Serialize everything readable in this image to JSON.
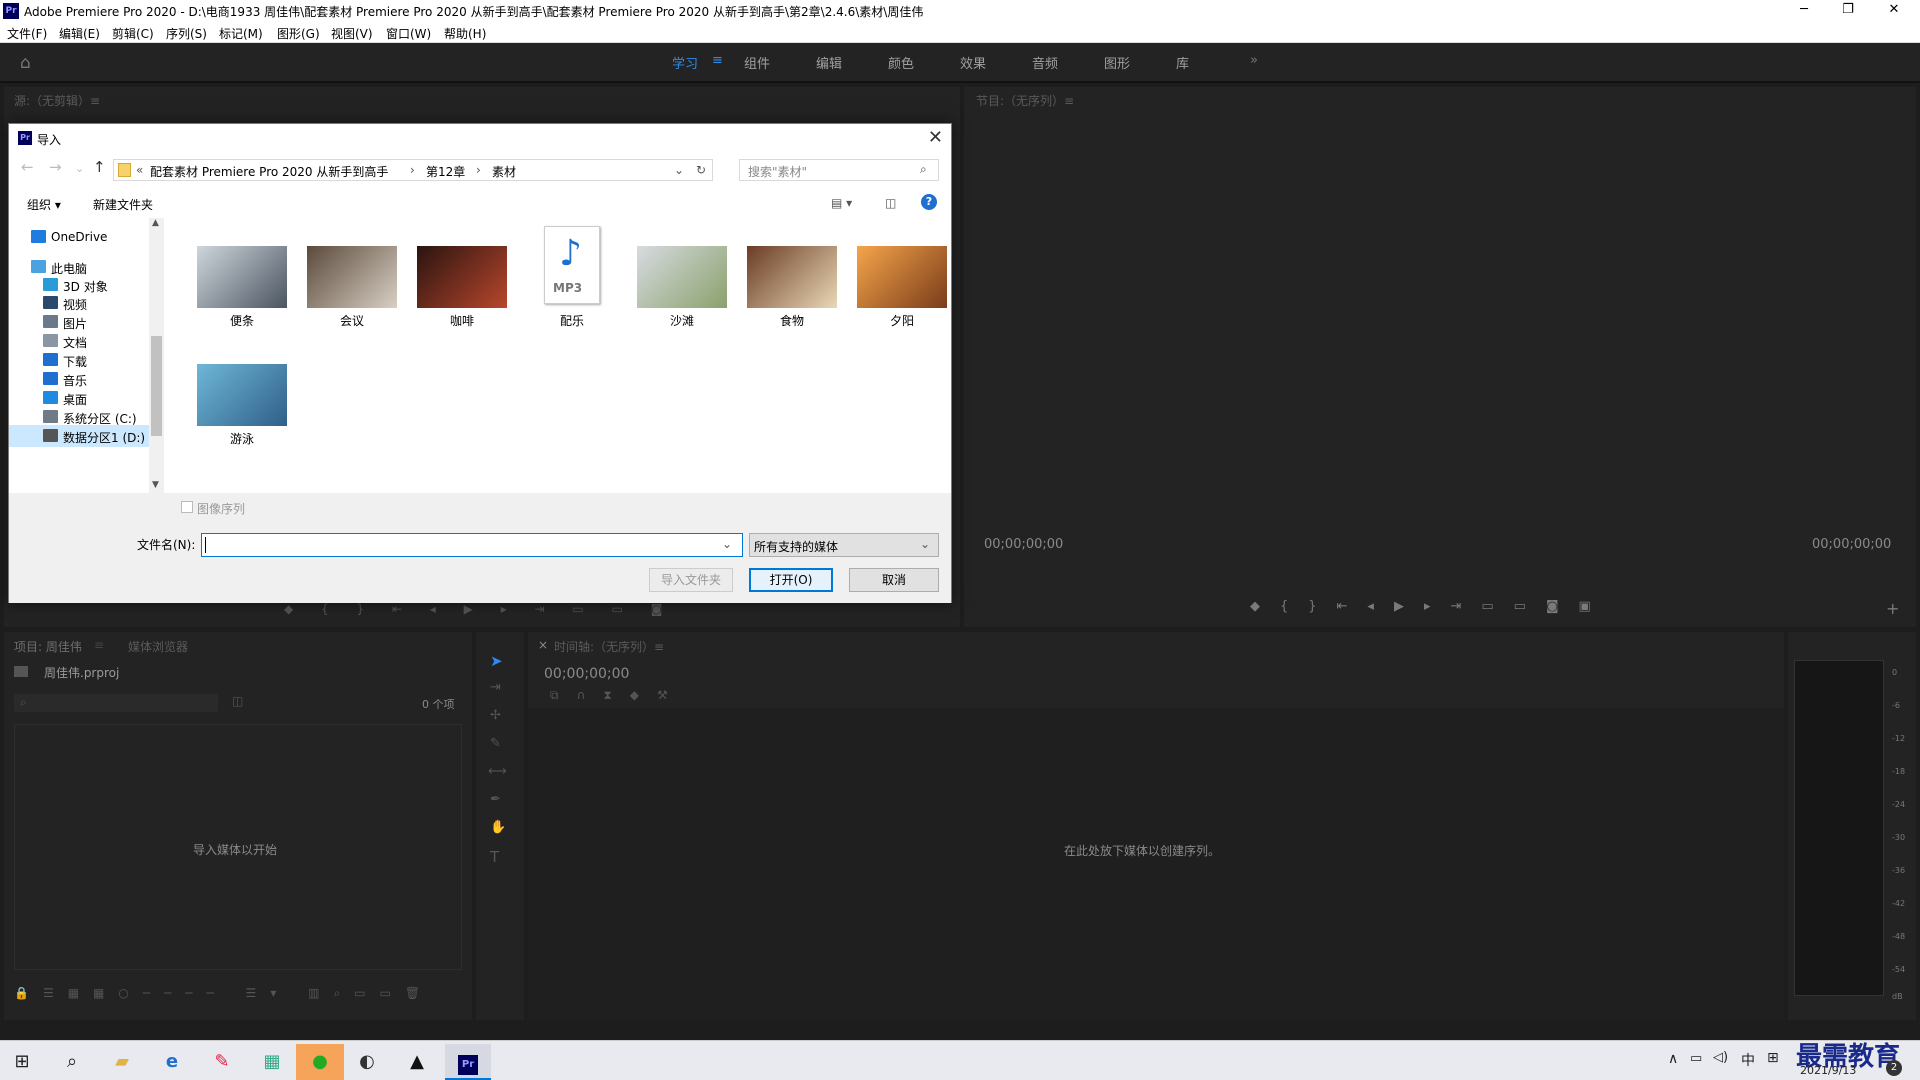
{
  "window": {
    "title": "Adobe Premiere Pro 2020 - D:\\电商1933 周佳伟\\配套素材 Premiere Pro 2020 从新手到高手\\配套素材 Premiere Pro 2020 从新手到高手\\第2章\\2.4.6\\素材\\周佳伟",
    "app_icon": "Pr",
    "min": "─",
    "max": "❐",
    "close": "✕"
  },
  "menu": [
    "文件(F)",
    "编辑(E)",
    "剪辑(C)",
    "序列(S)",
    "标记(M)",
    "图形(G)",
    "视图(V)",
    "窗口(W)",
    "帮助(H)"
  ],
  "workspaces": {
    "tabs": [
      "学习",
      "组件",
      "编辑",
      "颜色",
      "效果",
      "音频",
      "图形",
      "库"
    ],
    "active": "学习",
    "more": "»"
  },
  "source_panel": {
    "title": "源:（无剪辑）≡"
  },
  "program_panel": {
    "title": "节目:（无序列）≡",
    "timecode_left": "00;00;00;00",
    "timecode_right": "00;00;00;00"
  },
  "dialog": {
    "icon": "Pr",
    "title": "导入",
    "close": "✕",
    "nav": {
      "back": "←",
      "forward": "→",
      "recent": "⌄",
      "up": "↑",
      "refresh": "↻"
    },
    "address": {
      "prefix": "«",
      "parts": [
        "配套素材 Premiere Pro 2020 从新手到高手",
        "第12章",
        "素材"
      ],
      "sep": "›",
      "dropdown": "⌄"
    },
    "search": {
      "placeholder": "搜索\"素材\"",
      "icon": "⌕"
    },
    "toolbar": {
      "organize": "组织 ▾",
      "new_folder": "新建文件夹",
      "view": "▤ ▾",
      "pane": "◫",
      "help": "?"
    },
    "nav_pane": [
      {
        "label": "OneDrive",
        "icon": "cloud",
        "color": "#1e7be0"
      },
      {
        "label": "此电脑",
        "icon": "computer",
        "color": "#4aa3df"
      },
      {
        "label": "3D 对象",
        "icon": "cube",
        "color": "#2b9bd8"
      },
      {
        "label": "视频",
        "icon": "film",
        "color": "#2a4a6c"
      },
      {
        "label": "图片",
        "icon": "image",
        "color": "#6a7a8a"
      },
      {
        "label": "文档",
        "icon": "doc",
        "color": "#8a96a4"
      },
      {
        "label": "下载",
        "icon": "download",
        "color": "#1e6fd0"
      },
      {
        "label": "音乐",
        "icon": "music",
        "color": "#1e6fd0"
      },
      {
        "label": "桌面",
        "icon": "desktop",
        "color": "#1e8ae0"
      },
      {
        "label": "系统分区 (C:)",
        "icon": "drive",
        "color": "#6f7b86"
      },
      {
        "label": "数据分区1 (D:)",
        "icon": "drive",
        "color": "#555"
      }
    ],
    "files": [
      {
        "name": "便条",
        "type": "image",
        "c1": "#cfd6dd",
        "c2": "#4b5560"
      },
      {
        "name": "会议",
        "type": "image",
        "c1": "#5a4a3c",
        "c2": "#d8cfc3"
      },
      {
        "name": "咖啡",
        "type": "image",
        "c1": "#2a1410",
        "c2": "#b8462c"
      },
      {
        "name": "配乐",
        "type": "mp3",
        "label": "MP3"
      },
      {
        "name": "沙滩",
        "type": "image",
        "c1": "#d7dbe0",
        "c2": "#8aa16c"
      },
      {
        "name": "食物",
        "type": "image",
        "c1": "#6a3c24",
        "c2": "#e9d8b6"
      },
      {
        "name": "夕阳",
        "type": "image",
        "c1": "#f5a54a",
        "c2": "#7a3c1a"
      },
      {
        "name": "游泳",
        "type": "image",
        "c1": "#6fb7d6",
        "c2": "#2f5f8a"
      }
    ],
    "image_sequence": "图像序列",
    "filename_label": "文件名(N):",
    "filename_value": "",
    "filetype": "所有支持的媒体",
    "buttons": {
      "import_folder": "导入文件夹",
      "open": "打开(O)",
      "cancel": "取消"
    }
  },
  "project_panel": {
    "title": "项目: 周佳伟",
    "tab2": "媒体浏览器",
    "file": "周佳伟.prproj",
    "count": "0 个项",
    "empty": "导入媒体以开始"
  },
  "timeline_panel": {
    "close": "×",
    "title": "时间轴:（无序列）≡",
    "timecode": "00;00;00;00",
    "empty": "在此处放下媒体以创建序列。"
  },
  "meter": {
    "labels": [
      "0",
      "-6",
      "-12",
      "-18",
      "-24",
      "-30",
      "-36",
      "-42",
      "-48",
      "-54",
      "dB"
    ]
  },
  "taskbar": {
    "ime": "中",
    "date": "2021/9/13",
    "watermark": "最需教育",
    "notify": "2"
  }
}
